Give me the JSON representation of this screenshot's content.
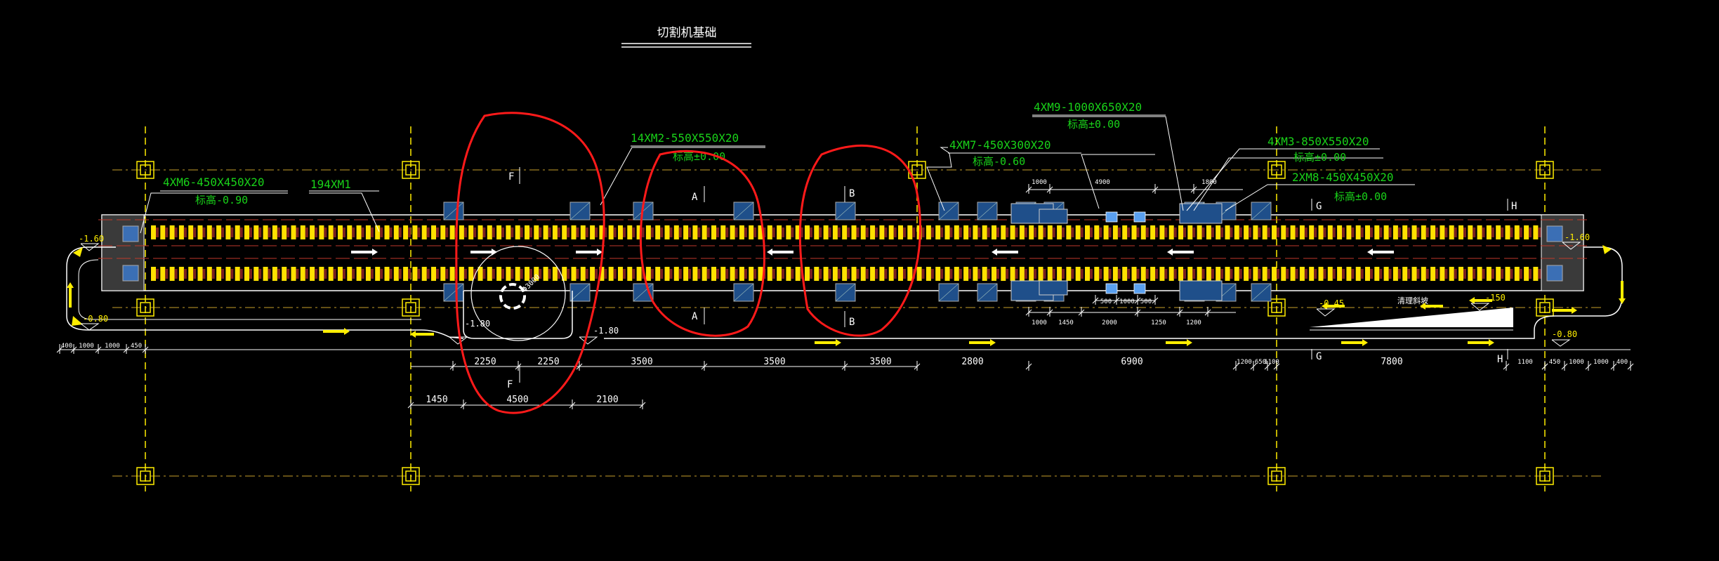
{
  "drawing": {
    "title": "切割机基础",
    "sections": {
      "F": "F",
      "A": "A",
      "B": "B",
      "G": "G",
      "H": "H"
    },
    "labels": {
      "xm6": "4XM6-450X450X20",
      "xm6_elev": "标高-0.90",
      "xm1": "194XM1",
      "xm2": "14XM2-550X550X20",
      "xm2_elev": "标高±0.00",
      "xm7": "4XM7-450X300X20",
      "xm7_elev": "标高-0.60",
      "xm9": "4XM9-1000X650X20",
      "xm9_elev": "标高±0.00",
      "xm3": "4XM3-850X550X20",
      "xm3_elev": "标高±0.00",
      "xm8": "2XM8-450X450X20",
      "xm8_elev": "标高±0.00"
    },
    "elevations": {
      "left_top": "-1.60",
      "left_bottom": "-0.80",
      "right_top": "-1.60",
      "right_bottom": "-0.80",
      "pit_left": "-1.80",
      "pit_right": "-1.80",
      "right_ramp_a": "-0.45",
      "right_ramp_b": "-150",
      "ramp_label": "清理斜坡"
    },
    "circle_label": "Φ3000",
    "dims_main": [
      "2250",
      "2250",
      "3500",
      "3500",
      "3500",
      "2800",
      "6900",
      "1200",
      "650",
      "1100",
      "7800",
      "1100"
    ],
    "dims_lower": [
      "1450",
      "4500",
      "2100"
    ],
    "dims_left": [
      "400",
      "1000",
      "1000",
      "450"
    ],
    "dims_right": [
      "450",
      "1000",
      "1000",
      "400"
    ],
    "dims_top_small": [
      "1000",
      "4900",
      "1800"
    ],
    "dims_mid_small": [
      "1000",
      "1450",
      "2000",
      "1250",
      "1200"
    ],
    "dims_mid_small2": [
      "500",
      "1000",
      "500"
    ]
  },
  "colors": {
    "background": "#000000",
    "annotation_green": "#19d219",
    "grid_yellow": "#ffee00",
    "centerline_red": "#c0392b",
    "markup_red": "#ff1a1a",
    "foundation_white": "#ffffff",
    "pad_blue": "#4a90d9",
    "roller_yellow": "#ffe100"
  }
}
